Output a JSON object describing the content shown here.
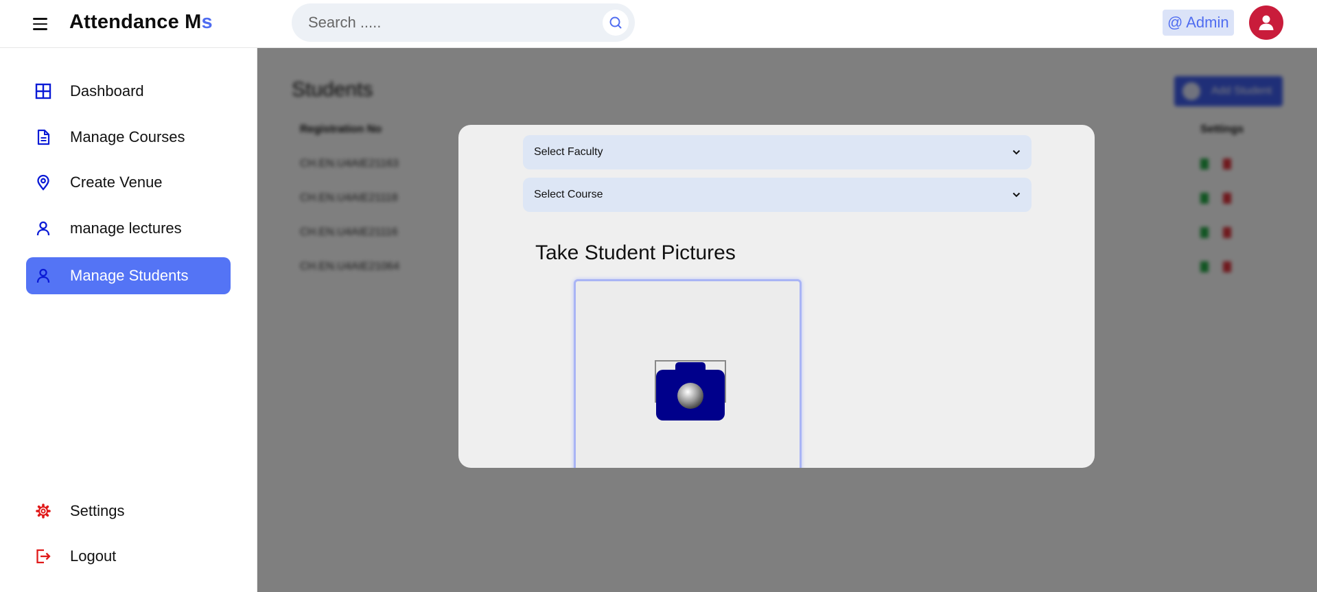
{
  "header": {
    "brand_main": "Attendance M",
    "brand_accent": "s",
    "search_placeholder": "Search .....",
    "admin_label": "@ Admin"
  },
  "sidebar": {
    "items": [
      {
        "label": "Dashboard",
        "icon": "grid-icon"
      },
      {
        "label": "Manage Courses",
        "icon": "document-icon"
      },
      {
        "label": "Create Venue",
        "icon": "location-pin-icon"
      },
      {
        "label": "manage lectures",
        "icon": "user-icon"
      },
      {
        "label": "Manage Students",
        "icon": "user-icon",
        "active": true
      }
    ],
    "bottom": [
      {
        "label": "Settings",
        "icon": "gear-icon"
      },
      {
        "label": "Logout",
        "icon": "logout-icon"
      }
    ]
  },
  "background_page": {
    "title": "Students",
    "add_button": "Add Student",
    "columns": [
      "Registration No",
      "Settings"
    ],
    "rows": [
      "CH.EN.U4AIE21163",
      "CH.EN.U4AIE21118",
      "CH.EN.U4AIE21116",
      "CH.EN.U4AIE21064"
    ]
  },
  "modal": {
    "faculty_select": "Select Faculty",
    "course_select": "Select Course",
    "heading": "Take Student Pictures"
  },
  "colors": {
    "accent": "#5474f5",
    "nav_icon": "#0a1ad6",
    "danger": "#e01919",
    "avatar": "#c91c3b",
    "camera": "#00008b"
  }
}
